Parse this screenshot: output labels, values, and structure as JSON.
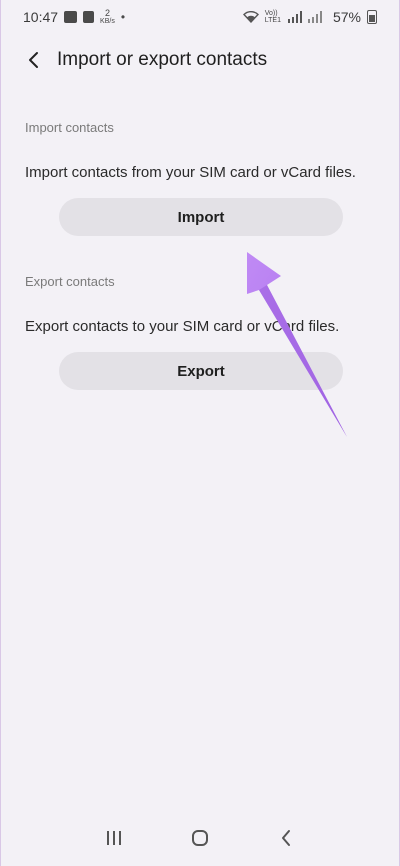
{
  "status_bar": {
    "time": "10:47",
    "data_rate_value": "2",
    "data_rate_unit": "KB/s",
    "volte_top": "Vo))",
    "volte_bottom": "LTE1",
    "battery": "57%"
  },
  "header": {
    "title": "Import or export contacts"
  },
  "import_section": {
    "label": "Import contacts",
    "description": "Import contacts from your SIM card or vCard files.",
    "button_label": "Import"
  },
  "export_section": {
    "label": "Export contacts",
    "description": "Export contacts to your SIM card or vCard files.",
    "button_label": "Export"
  },
  "colors": {
    "background": "#f3f1f6",
    "button_bg": "#e3e1e6",
    "arrow": "#b77ff0"
  },
  "icons": {
    "back": "chevron-left-icon",
    "nav_recents": "recents-icon",
    "nav_home": "home-icon",
    "nav_back": "back-icon"
  }
}
